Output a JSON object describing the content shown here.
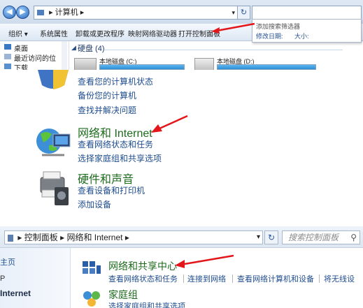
{
  "explorer": {
    "address": {
      "computer_label": "计算机",
      "separator": "▸"
    },
    "search_dropdown": {
      "title": "添加搜索筛选器",
      "filter1": "修改日期:",
      "filter2": "大小:"
    },
    "toolbar": {
      "organize": "组织 ▾",
      "system_properties": "系统属性",
      "uninstall": "卸载或更改程序",
      "map_drive": "映射网络驱动器",
      "open_control_panel": "打开控制面板"
    },
    "sidebar": [
      {
        "label": "桌面"
      },
      {
        "label": "最近访问的位"
      },
      {
        "label": "下载"
      }
    ],
    "drives_header": "硬盘 (4)",
    "drives": [
      {
        "label": "本地磁盘 (C:)"
      },
      {
        "label": "本地磁盘 (D:)"
      }
    ]
  },
  "control_panel": {
    "system_links": [
      "查看您的计算机状态",
      "备份您的计算机",
      "查找并解决问题"
    ],
    "network_title": "网络和 Internet",
    "network_links": [
      "查看网络状态和任务",
      "选择家庭组和共享选项"
    ],
    "hardware_title": "硬件和声音",
    "hardware_links": [
      "查看设备和打印机",
      "添加设备"
    ]
  },
  "network_panel": {
    "breadcrumb": {
      "control_panel": "控制面板",
      "network_internet": "网络和 Internet"
    },
    "search_placeholder": "搜索控制面板",
    "left_nav": {
      "home_fragment": "主页",
      "internet_fragment": "Internet",
      "p_fragment": "P"
    },
    "sharing_center_title": "网络和共享中心",
    "sharing_links": [
      "查看网络状态和任务",
      "连接到网络",
      "查看网络计算机和设备",
      "将无线设"
    ],
    "homegroup_title": "家庭组",
    "homegroup_link": "选择家庭组和共享选项"
  },
  "colors": {
    "arrow": "#e3161b",
    "link": "#1f4d8f",
    "category_title": "#1d6b1d"
  }
}
